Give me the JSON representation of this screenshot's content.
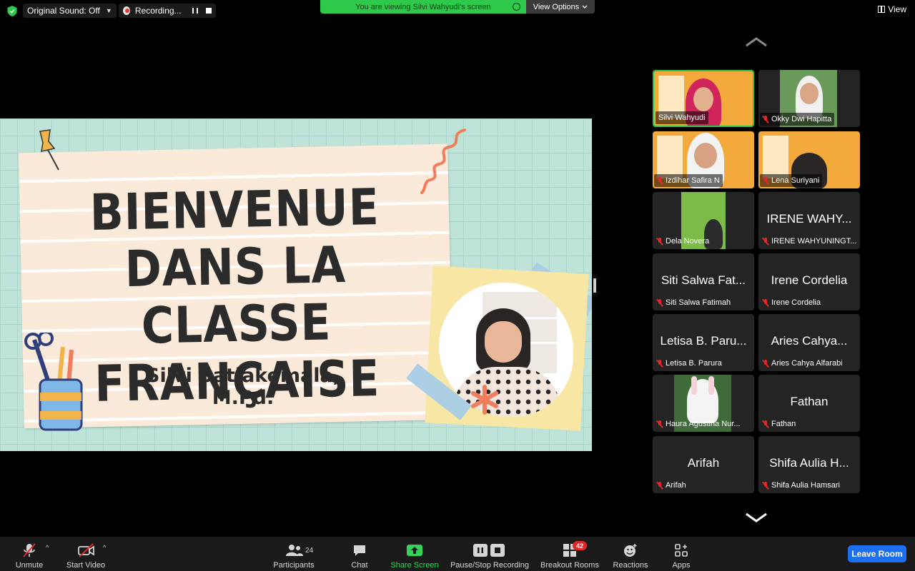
{
  "topbar": {
    "original_sound": "Original Sound: Off",
    "recording": "Recording...",
    "viewing_banner": "You are viewing Silvi Wahyudi's screen",
    "view_options": "View Options",
    "view": "View"
  },
  "slide": {
    "title_line1": "BIENVENUE",
    "title_line2": "DANS LA CLASSE",
    "title_line3": "FRANÇAISE",
    "subtitle": "Silvi Satiakemala, M.Pd."
  },
  "participants": [
    {
      "label": "Silvi Wahyudi",
      "big": "",
      "muted": false,
      "active": true,
      "kind": "slide-video"
    },
    {
      "label": "Okky Dwi Hapitta",
      "big": "",
      "muted": true,
      "active": false,
      "kind": "video"
    },
    {
      "label": "Izdihar Safira N",
      "big": "",
      "muted": true,
      "active": false,
      "kind": "slide-video"
    },
    {
      "label": "Lena Suriyani",
      "big": "",
      "muted": true,
      "active": false,
      "kind": "slide-video"
    },
    {
      "label": "Dela Novera",
      "big": "",
      "muted": true,
      "active": false,
      "kind": "video"
    },
    {
      "label": "IRENE WAHYUNINGT...",
      "big": "IRENE WAHY...",
      "muted": true,
      "active": false,
      "kind": "name"
    },
    {
      "label": "Siti Salwa Fatimah",
      "big": "Siti Salwa Fat...",
      "muted": true,
      "active": false,
      "kind": "name"
    },
    {
      "label": "Irene Cordelia",
      "big": "Irene Cordelia",
      "muted": true,
      "active": false,
      "kind": "name"
    },
    {
      "label": "Letisa B. Parura",
      "big": "Letisa B. Paru...",
      "muted": true,
      "active": false,
      "kind": "name"
    },
    {
      "label": "Aries Cahya Alfarabi",
      "big": "Aries Cahya...",
      "muted": true,
      "active": false,
      "kind": "name"
    },
    {
      "label": "Haura Agustina Nur...",
      "big": "",
      "muted": true,
      "active": false,
      "kind": "video"
    },
    {
      "label": "Fathan",
      "big": "Fathan",
      "muted": true,
      "active": false,
      "kind": "name"
    },
    {
      "label": "Arifah",
      "big": "Arifah",
      "muted": true,
      "active": false,
      "kind": "name"
    },
    {
      "label": "Shifa Aulia Hamsari",
      "big": "Shifa Aulia H...",
      "muted": true,
      "active": false,
      "kind": "name"
    }
  ],
  "toolbar": {
    "unmute": "Unmute",
    "start_video": "Start Video",
    "participants": "Participants",
    "participants_count": "24",
    "chat": "Chat",
    "share_screen": "Share Screen",
    "pause_stop_recording": "Pause/Stop Recording",
    "breakout_rooms": "Breakout Rooms",
    "breakout_count": "42",
    "reactions": "Reactions",
    "apps": "Apps",
    "leave_room": "Leave Room"
  },
  "colors": {
    "accent_green": "#2ec84a",
    "leave_blue": "#1d6ff2",
    "muted_red": "#e02828"
  }
}
